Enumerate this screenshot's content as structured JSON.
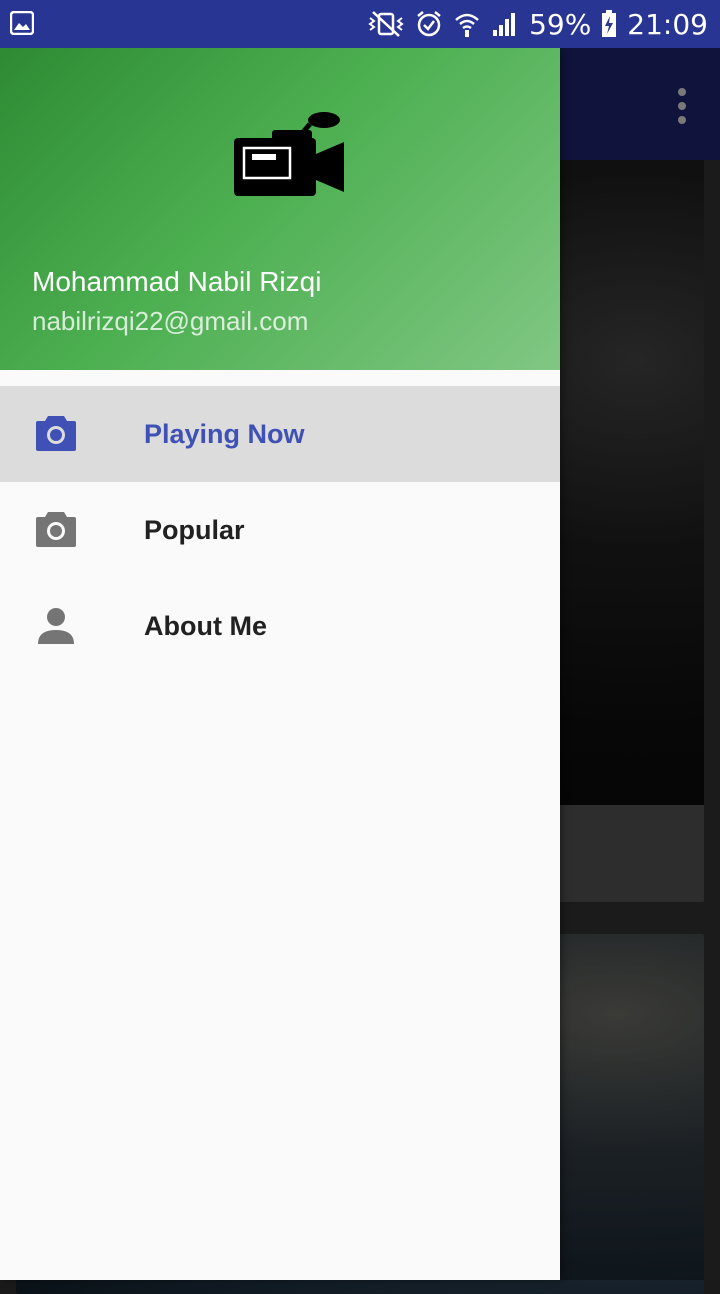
{
  "status_bar": {
    "battery_percent": "59%",
    "time": "21:09",
    "icons": [
      "image-notification-icon",
      "vibrate-icon",
      "alarm-icon",
      "wifi-icon",
      "signal-icon",
      "battery-charging-icon"
    ]
  },
  "app_bar": {
    "overflow_icon": "more-vert-icon"
  },
  "drawer": {
    "header": {
      "logo_icon": "video-camera-icon",
      "user_name": "Mohammad Nabil Rizqi",
      "user_email": "nabilrizqi22@gmail.com"
    },
    "items": [
      {
        "label": "Playing Now",
        "icon": "camera-icon",
        "active": true
      },
      {
        "label": "Popular",
        "icon": "camera-icon",
        "active": false
      },
      {
        "label": "About Me",
        "icon": "person-icon",
        "active": false
      }
    ]
  },
  "colors": {
    "status_bar": "#283593",
    "app_bar": "#1a1f5c",
    "header_start": "#2e8b34",
    "header_end": "#81c784",
    "active_item_text": "#3f51b5",
    "active_item_bg": "#dcdcdc"
  }
}
